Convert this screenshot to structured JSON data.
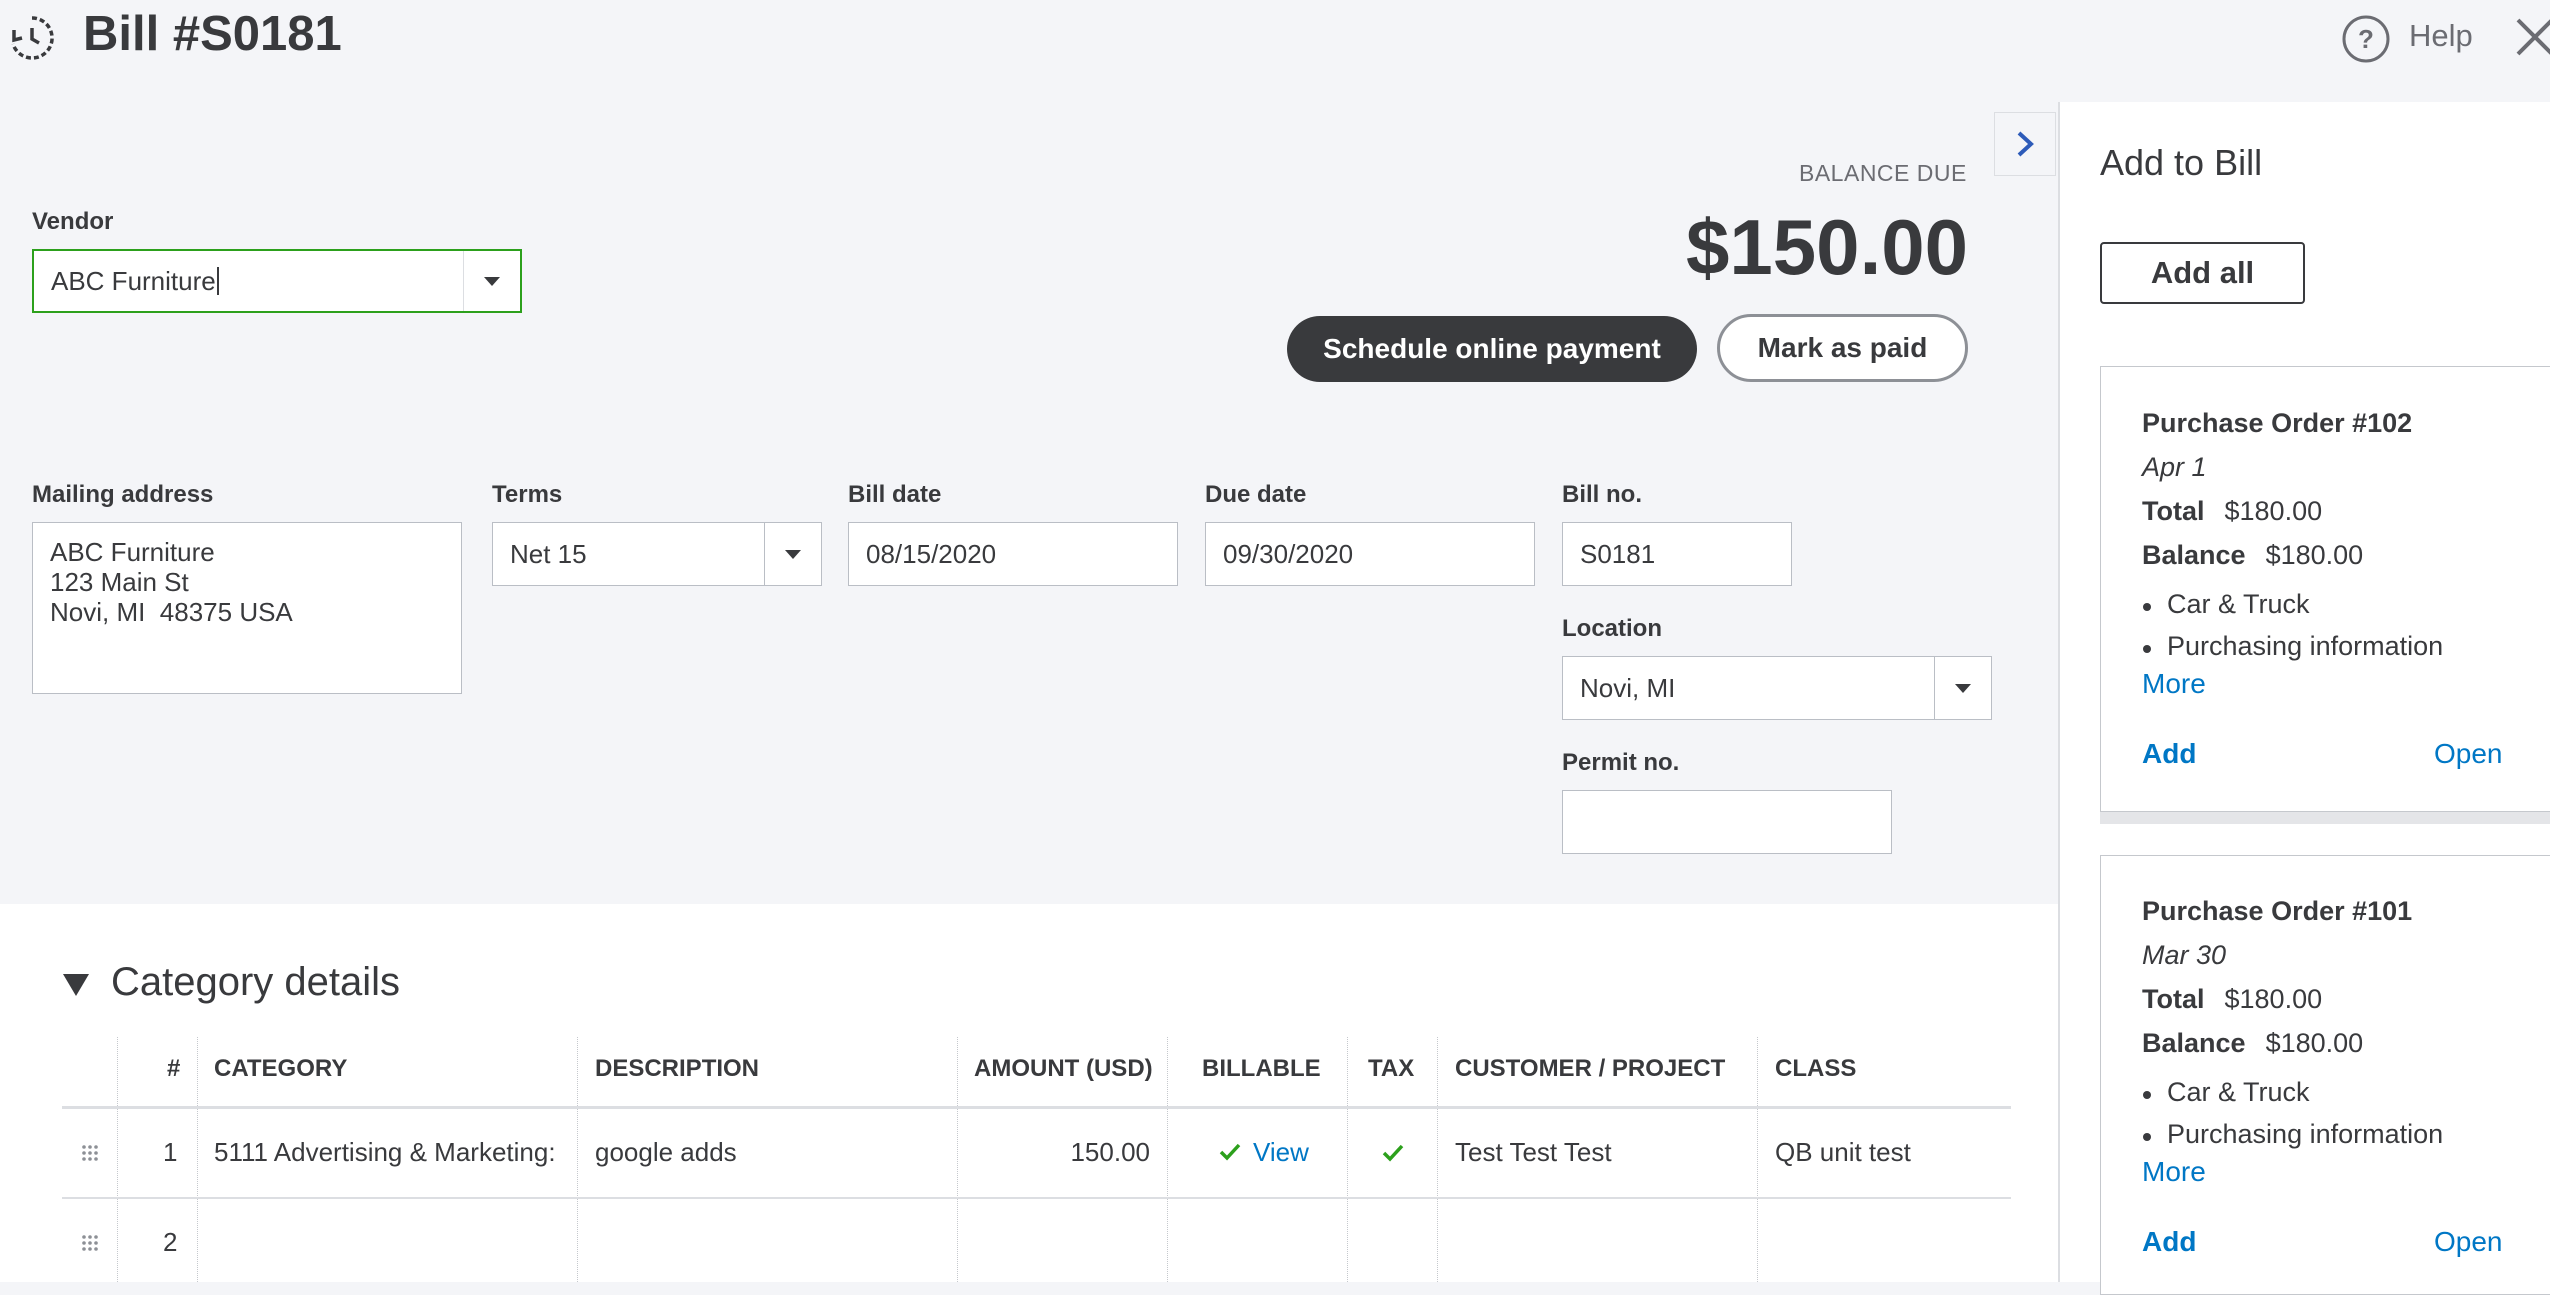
{
  "header": {
    "title": "Bill #S0181",
    "help_label": "Help",
    "icons": [
      "history-icon",
      "help-icon",
      "close-icon"
    ]
  },
  "vendor": {
    "label": "Vendor",
    "value": "ABC Furniture"
  },
  "balance": {
    "label": "BALANCE DUE",
    "amount": "$150.00"
  },
  "actions": {
    "schedule_label": "Schedule online payment",
    "mark_paid_label": "Mark as paid"
  },
  "mailing": {
    "label": "Mailing address",
    "line1": "ABC Furniture",
    "line2": "123 Main St",
    "line3": "Novi, MI  48375 USA"
  },
  "terms": {
    "label": "Terms",
    "value": "Net 15"
  },
  "bill_date": {
    "label": "Bill date",
    "value": "08/15/2020"
  },
  "due_date": {
    "label": "Due date",
    "value": "09/30/2020"
  },
  "bill_no": {
    "label": "Bill no.",
    "value": "S0181"
  },
  "location": {
    "label": "Location",
    "value": "Novi, MI"
  },
  "permit": {
    "label": "Permit no.",
    "value": ""
  },
  "category": {
    "title": "Category details",
    "columns": [
      "#",
      "CATEGORY",
      "DESCRIPTION",
      "AMOUNT (USD)",
      "BILLABLE",
      "TAX",
      "CUSTOMER / PROJECT",
      "CLASS"
    ],
    "rows": [
      {
        "num": "1",
        "category": "5111 Advertising & Marketing:",
        "description": "google adds",
        "amount": "150.00",
        "billable": "View",
        "tax": true,
        "customer": "Test Test Test",
        "class": "QB unit test"
      },
      {
        "num": "2",
        "category": "",
        "description": "",
        "amount": "",
        "billable": "",
        "tax": false,
        "customer": "",
        "class": ""
      }
    ]
  },
  "side_panel": {
    "title": "Add to Bill",
    "add_all_label": "Add all",
    "cards": [
      {
        "title": "Purchase Order #102",
        "date": "Apr 1",
        "total_label": "Total",
        "total": "$180.00",
        "balance_label": "Balance",
        "balance": "$180.00",
        "items": [
          "Car & Truck",
          "Purchasing information"
        ],
        "more": "More",
        "add": "Add",
        "open": "Open"
      },
      {
        "title": "Purchase Order #101",
        "date": "Mar 30",
        "total_label": "Total",
        "total": "$180.00",
        "balance_label": "Balance",
        "balance": "$180.00",
        "items": [
          "Car & Truck",
          "Purchasing information"
        ],
        "more": "More",
        "add": "Add",
        "open": "Open"
      }
    ]
  },
  "colors": {
    "background": "#f4f5f8",
    "primary_dark": "#393a3d",
    "link_blue": "#0077c5",
    "vendor_focus_green": "#2ca01c",
    "check_green": "#2ca01c"
  }
}
